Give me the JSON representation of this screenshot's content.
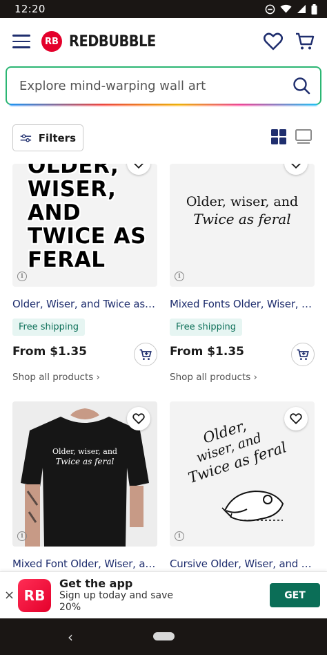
{
  "status_bar": {
    "time": "12:20"
  },
  "header": {
    "logo_mark": "RB",
    "logo_text": "REDBUBBLE"
  },
  "search": {
    "placeholder": "Explore mind-warping wall art"
  },
  "toolbar": {
    "filters_label": "Filters"
  },
  "products": [
    {
      "title": "Older, Wiser, and Twice as ...",
      "badge": "Free shipping",
      "price": "From $1.35",
      "shop_all": "Shop all products ›",
      "art_lines": [
        "OLDER,",
        "WISER,",
        "AND",
        "TWICE AS",
        "FERAL"
      ]
    },
    {
      "title": "Mixed Fonts Older, Wiser, a...",
      "badge": "Free shipping",
      "price": "From $1.35",
      "shop_all": "Shop all products ›",
      "art_line1": "Older, wiser, and",
      "art_line2": "Twice as feral"
    },
    {
      "title": "Mixed Font Older, Wiser, an...",
      "art_line1": "Older, wiser, and",
      "art_line2": "Twice as feral"
    },
    {
      "title": "Cursive Older, Wiser, and T...",
      "art_line1": "Older,",
      "art_line2": "wiser, and",
      "art_line3": "Twice as feral"
    }
  ],
  "app_banner": {
    "close": "×",
    "icon_text": "RB",
    "title": "Get the app",
    "subtitle": "Sign up today and save 20%",
    "button": "GET"
  },
  "nav": {
    "back": "‹"
  },
  "colors": {
    "brand_red": "#e4002b",
    "navy": "#1f2e6e",
    "green": "#0b6e57",
    "search_border": "#2bb673"
  }
}
